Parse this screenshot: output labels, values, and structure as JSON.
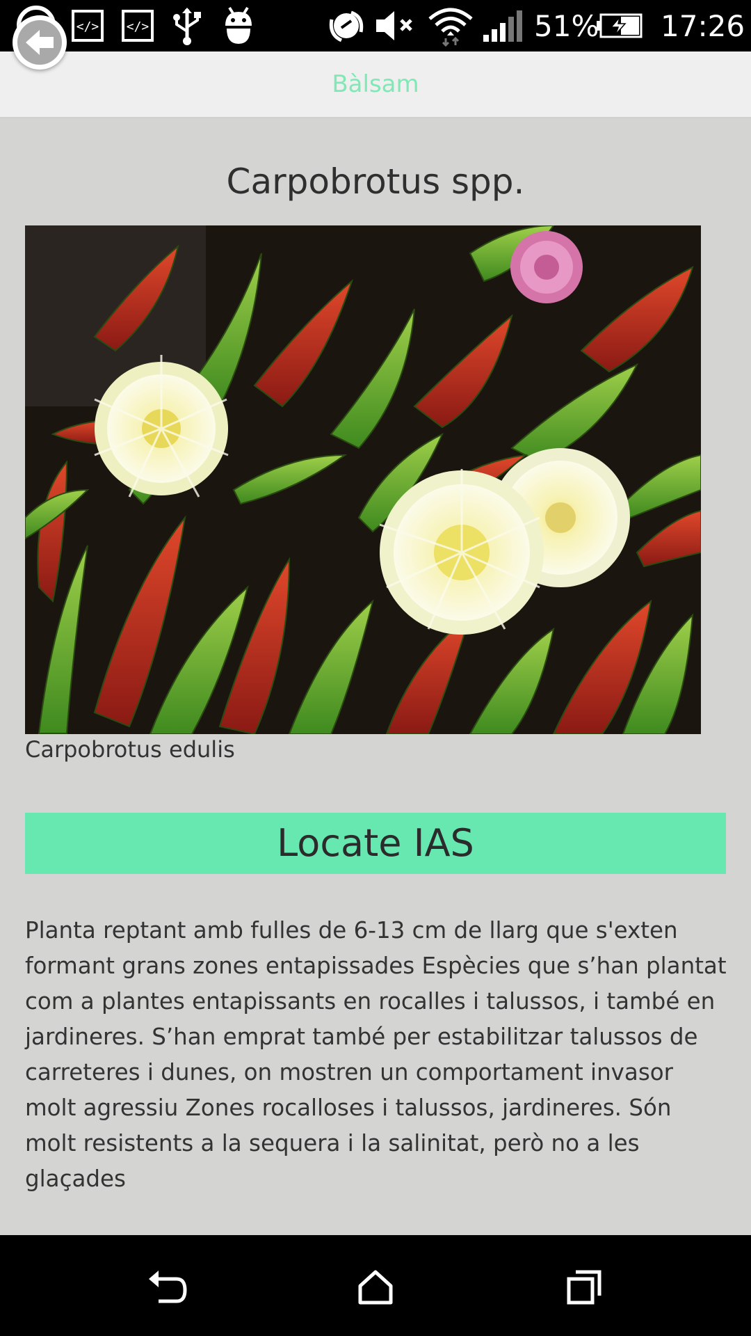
{
  "status_bar": {
    "battery_percent": "51%",
    "time": "17:26",
    "icons": [
      "whatsapp-icon",
      "code-icon",
      "code-icon",
      "usb-icon",
      "android-debug-icon",
      "nfc-icon",
      "volume-muted-icon",
      "wifi-icon",
      "signal-icon",
      "battery-charging-icon"
    ]
  },
  "header": {
    "title": "Bàlsam",
    "back_icon": "back-arrow-icon",
    "title_color": "#7fe9b6"
  },
  "species": {
    "title": "Carpobrotus spp.",
    "photo_caption": "Carpobrotus edulis"
  },
  "locate_button": {
    "label": "Locate IAS",
    "color": "#66e8b0"
  },
  "description": "Planta reptant amb fulles de 6-13 cm de llarg que s'exten formant grans zones entapissades Espècies que s’han plantat com a plantes entapissants en rocalles i talussos, i també en jardineres. S’han emprat també per estabilitzar talussos de carreteres i dunes, on mostren un comportament invasor molt agressiu Zones rocalloses i talussos, jardineres. Són molt resistents a la sequera i la salinitat, però no a les glaçades",
  "nav_bar": {
    "icons": [
      "back-nav-icon",
      "home-nav-icon",
      "recents-nav-icon"
    ]
  }
}
